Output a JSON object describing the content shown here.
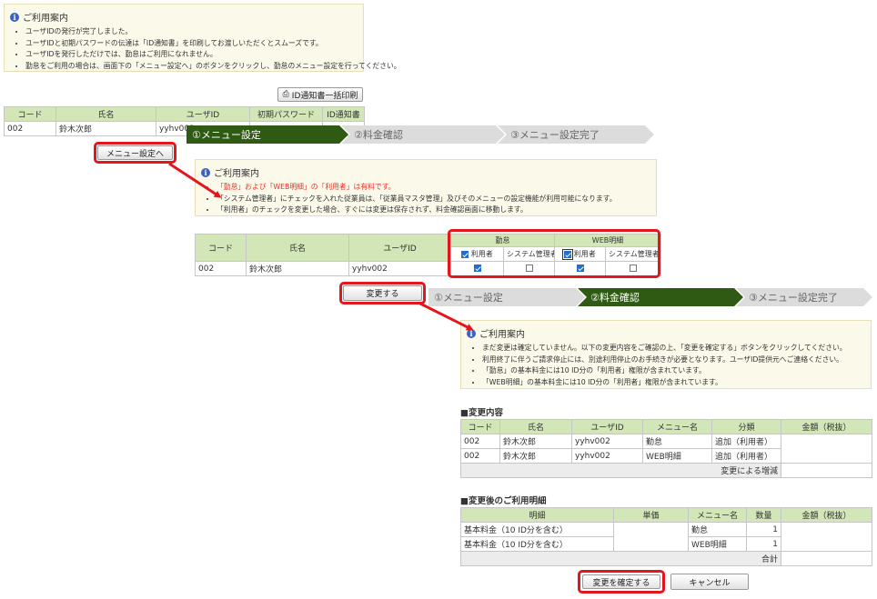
{
  "info1": {
    "title": "ご利用案内",
    "items": [
      "ユーザIDの発行が完了しました。",
      "ユーザIDと初期パスワードの伝達は「ID通知書」を印刷してお渡しいただくとスムーズです。",
      "ユーザIDを発行しただけでは、勤怠はご利用になれません。",
      "勤怠をご利用の場合は、画面下の「メニュー設定へ」のボタンをクリックし、勤怠のメニュー設定を行ってください。"
    ]
  },
  "print_button": "ID通知書一括印刷",
  "table1": {
    "headers": [
      "コード",
      "氏名",
      "ユーザID",
      "初期パスワード",
      "ID通知書"
    ],
    "row": [
      "002",
      "鈴木次郎",
      "yyhv002"
    ]
  },
  "menu_button": "メニュー設定へ",
  "steps": [
    "①メニュー設定",
    "②料金確認",
    "③メニュー設定完了"
  ],
  "info2": {
    "title": "ご利用案内",
    "items": [
      "「勤怠」および「WEB明細」の「利用者」は有料です。",
      "「システム管理者」にチェックを入れた従業員は、「従業員マスタ管理」及びそのメニューの設定機能が利用可能になります。",
      "「利用者」のチェックを変更した場合、すぐには変更は保存されず、料金確認画面に移動します。"
    ]
  },
  "table2": {
    "headers": [
      "コード",
      "氏名",
      "ユーザID"
    ],
    "group1": "勤怠",
    "group2": "WEB明細",
    "sub_user": "利用者",
    "sub_admin": "システム管理者",
    "row": [
      "002",
      "鈴木次郎",
      "yyhv002"
    ]
  },
  "change_button": "変更する",
  "info3": {
    "title": "ご利用案内",
    "items": [
      "まだ変更は確定していません。以下の変更内容をご確認の上、「変更を確定する」ボタンをクリックしてください。",
      "利用終了に伴うご請求停止には、別途利用停止のお手続きが必要となります。ユーザID提供元へご連絡ください。",
      "「勤怠」の基本料金には10 ID分の「利用者」権限が含まれています。",
      "「WEB明細」の基本料金には10 ID分の「利用者」権限が含まれています。"
    ]
  },
  "changes": {
    "title": "■変更内容",
    "headers": [
      "コード",
      "氏名",
      "ユーザID",
      "メニュー名",
      "分類",
      "金額（税抜）"
    ],
    "rows": [
      [
        "002",
        "鈴木次郎",
        "yyhv002",
        "勤怠",
        "追加（利用者）"
      ],
      [
        "002",
        "鈴木次郎",
        "yyhv002",
        "WEB明細",
        "追加（利用者）"
      ]
    ],
    "subtotal": "変更による増減"
  },
  "details": {
    "title": "■変更後のご利用明細",
    "headers": [
      "明細",
      "単価",
      "メニュー名",
      "数量",
      "金額（税抜）"
    ],
    "rows": [
      [
        "基本料金（10 ID分を含む）",
        "勤怠",
        "1"
      ],
      [
        "基本料金（10 ID分を含む）",
        "WEB明細",
        "1"
      ]
    ],
    "total": "合計"
  },
  "confirm_button": "変更を確定する",
  "cancel_button": "キャンセル",
  "colors": {
    "accent": "#2f5a13",
    "highlight": "#e4151d",
    "table_header": "#d2e6b8",
    "info_bg": "#fbf9ea"
  }
}
